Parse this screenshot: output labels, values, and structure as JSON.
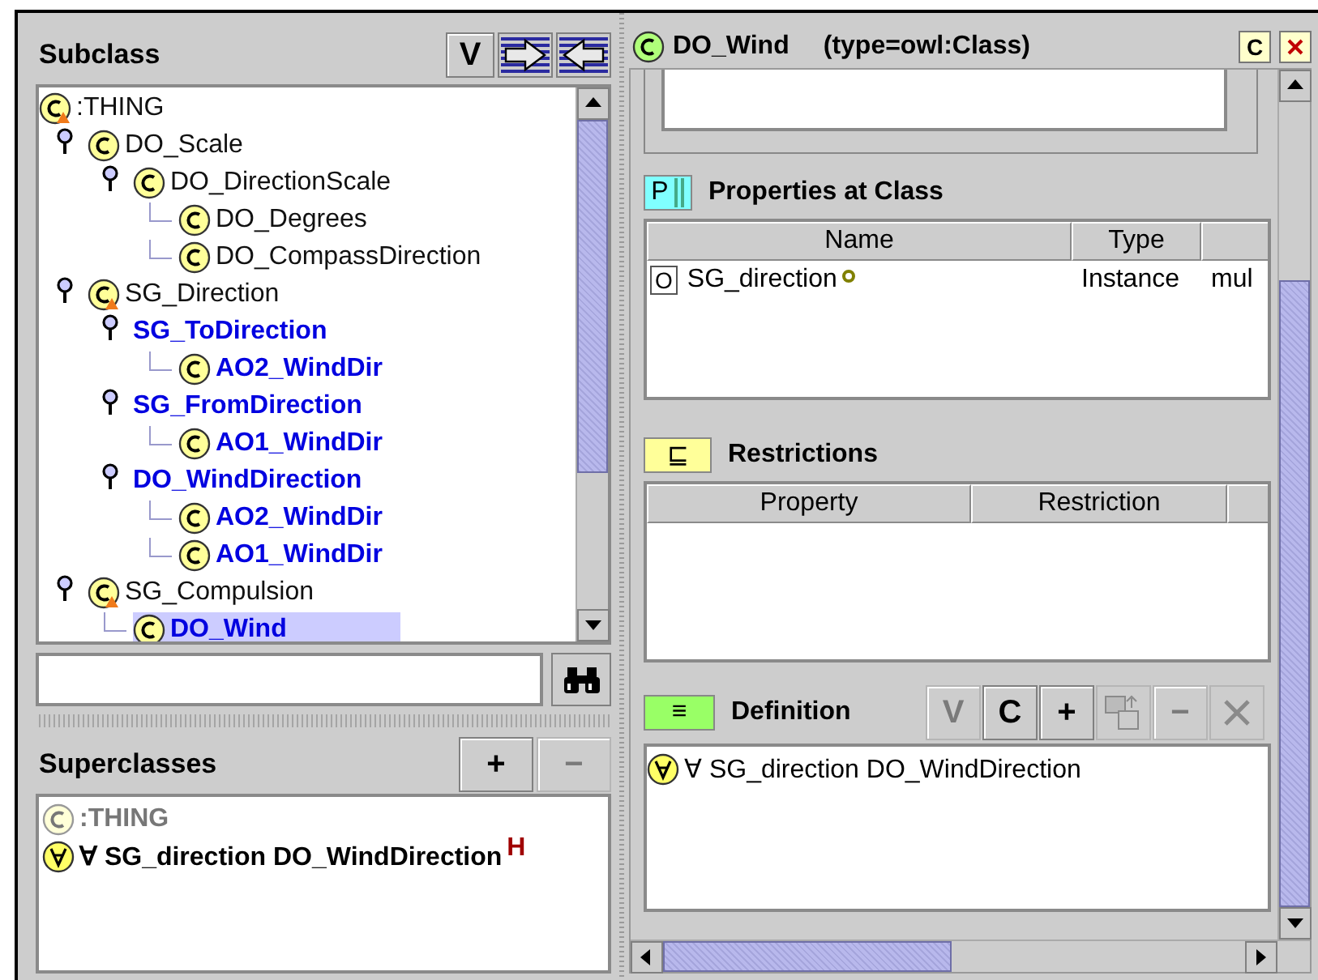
{
  "subclass_panel": {
    "title": "Subclass",
    "buttons": [
      {
        "kind": "text",
        "label": "V"
      },
      {
        "kind": "arrow-right"
      },
      {
        "kind": "arrow-left"
      }
    ],
    "tree": [
      {
        "label": ":THING",
        "kind": "class-warning",
        "emphasized": false,
        "selected": false,
        "children": [
          {
            "label": "DO_Scale",
            "kind": "class",
            "emphasized": false,
            "selected": false,
            "expanded": true,
            "children": [
              {
                "label": "DO_DirectionScale",
                "kind": "class",
                "emphasized": false,
                "selected": false,
                "expanded": true,
                "children": [
                  {
                    "label": "DO_Degrees",
                    "kind": "class",
                    "emphasized": false,
                    "selected": false
                  },
                  {
                    "label": "DO_CompassDirection",
                    "kind": "class",
                    "emphasized": false,
                    "selected": false
                  }
                ]
              }
            ]
          },
          {
            "label": "SG_Direction",
            "kind": "class-warning",
            "emphasized": false,
            "selected": false,
            "expanded": true,
            "children": [
              {
                "label": "SG_ToDirection",
                "kind": "plain",
                "emphasized": true,
                "selected": false,
                "expanded": true,
                "children": [
                  {
                    "label": "AO2_WindDir",
                    "kind": "class",
                    "emphasized": true,
                    "selected": false
                  }
                ]
              },
              {
                "label": "SG_FromDirection",
                "kind": "plain",
                "emphasized": true,
                "selected": false,
                "expanded": true,
                "children": [
                  {
                    "label": "AO1_WindDir",
                    "kind": "class",
                    "emphasized": true,
                    "selected": false
                  }
                ]
              },
              {
                "label": "DO_WindDirection",
                "kind": "plain",
                "emphasized": true,
                "selected": false,
                "expanded": true,
                "children": [
                  {
                    "label": "AO2_WindDir",
                    "kind": "class",
                    "emphasized": true,
                    "selected": false
                  },
                  {
                    "label": "AO1_WindDir",
                    "kind": "class",
                    "emphasized": true,
                    "selected": false
                  }
                ]
              }
            ]
          },
          {
            "label": "SG_Compulsion",
            "kind": "class-warning",
            "emphasized": false,
            "selected": false,
            "expanded": true,
            "children": [
              {
                "label": "DO_Wind",
                "kind": "class",
                "emphasized": true,
                "selected": true
              }
            ]
          }
        ]
      }
    ]
  },
  "superclasses_panel": {
    "title": "Superclasses",
    "buttons": [
      {
        "label": "+",
        "disabled": false
      },
      {
        "label": "−",
        "disabled": true
      }
    ],
    "items": [
      {
        "kind": "class",
        "label": ":THING",
        "inherited": true
      },
      {
        "kind": "restriction",
        "label": "∀ SG_direction DO_WindDirection",
        "inherited": false,
        "badge": "H"
      }
    ]
  },
  "class_header": {
    "name": "DO_Wind",
    "type": "(type=owl:Class)",
    "buttons": [
      {
        "kind": "text",
        "label": "C"
      },
      {
        "kind": "close"
      }
    ]
  },
  "properties": {
    "badge": "P",
    "title": "Properties at Class",
    "columns": [
      "Name",
      "Type"
    ],
    "rows": [
      {
        "marker": "O",
        "cells": [
          "SG_direction",
          "Instance",
          "mul"
        ]
      }
    ]
  },
  "restrictions": {
    "badge": "⊑",
    "title": "Restrictions",
    "columns": [
      "Property",
      "Restriction"
    ]
  },
  "definition": {
    "badge": "≡",
    "title": "Definition",
    "buttons": [
      {
        "kind": "text",
        "label": "V",
        "disabled": true
      },
      {
        "kind": "text",
        "label": "C",
        "disabled": false
      },
      {
        "kind": "text",
        "label": "+",
        "disabled": false
      },
      {
        "kind": "copy",
        "disabled": true
      },
      {
        "kind": "text",
        "label": "−",
        "disabled": true
      },
      {
        "kind": "delete",
        "disabled": true
      }
    ],
    "items": [
      {
        "kind": "restriction",
        "label": "∀ SG_direction DO_WindDirection"
      }
    ]
  }
}
